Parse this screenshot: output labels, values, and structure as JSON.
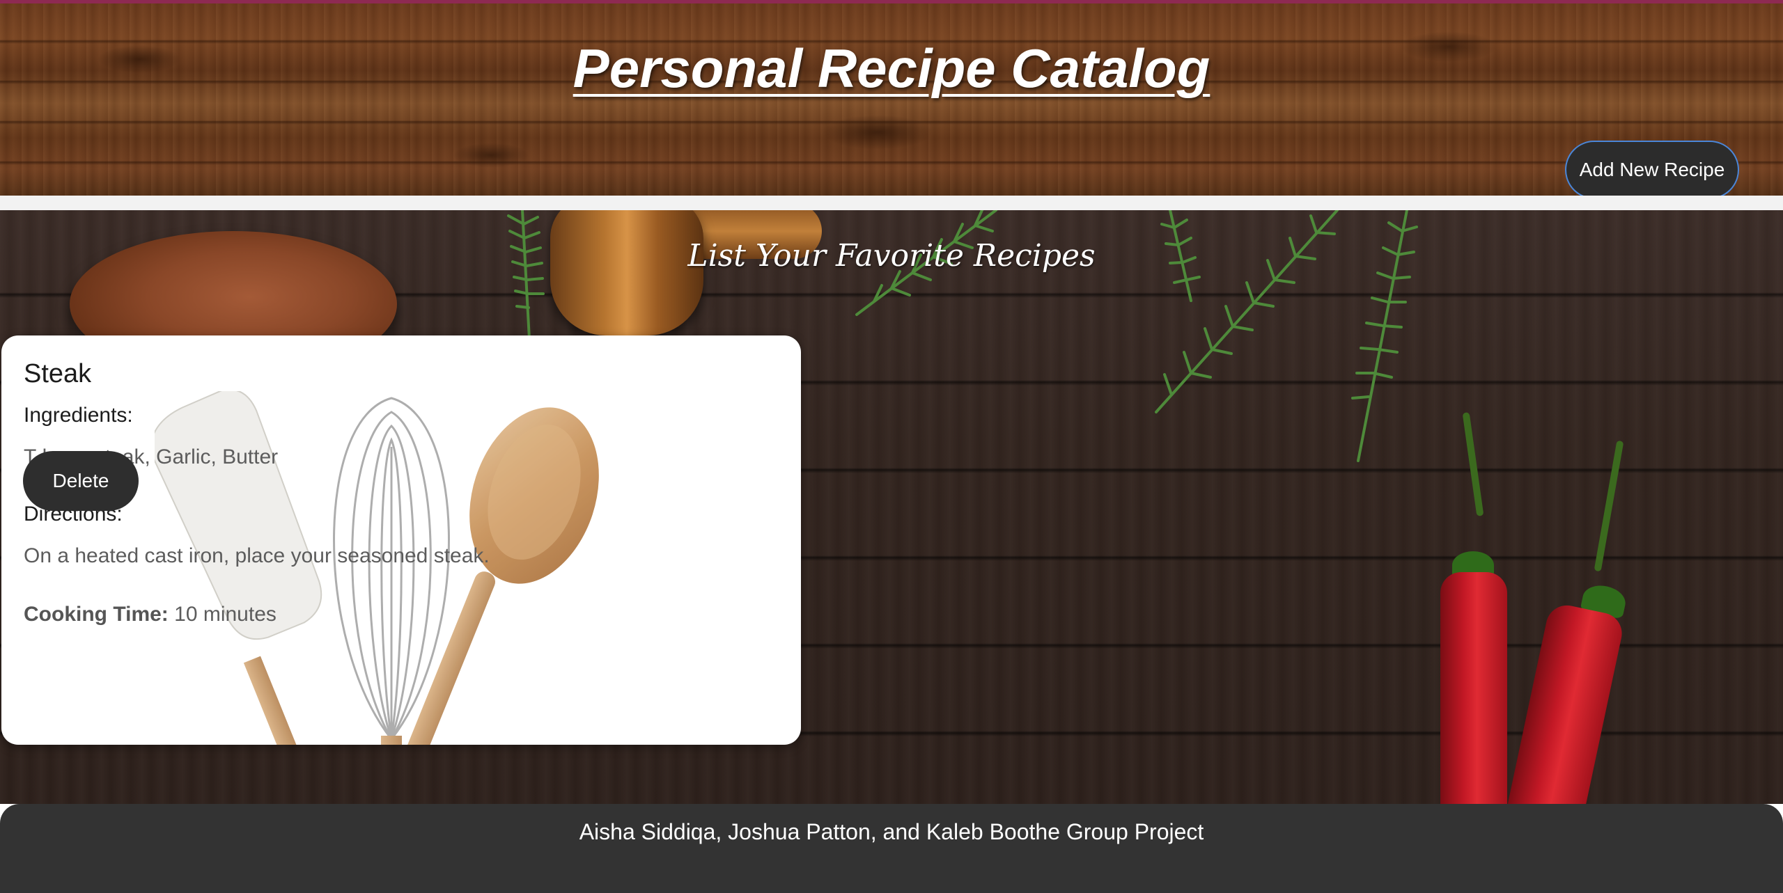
{
  "header": {
    "title": "Personal Recipe Catalog",
    "add_button_label": "Add New Recipe"
  },
  "main": {
    "subtitle": "List Your Favorite Recipes"
  },
  "recipes": [
    {
      "name": "Steak",
      "ingredients_label": "Ingredients:",
      "ingredients": "T-bone steak, Garlic, Butter",
      "directions_label": "Directions:",
      "directions": "On a heated cast iron, place your seasoned steak.",
      "cooking_time_label": "Cooking Time:",
      "cooking_time": "10 minutes",
      "delete_label": "Delete"
    }
  ],
  "footer": {
    "text": "Aisha Siddiqa, Joshua Patton, and Kaleb Boothe Group Project"
  },
  "colors": {
    "top_strip": "#8e2a52",
    "button_dark": "#2c2c2c",
    "button_border": "#4a86d8",
    "footer_bg": "#333333",
    "card_bg": "#ffffff"
  },
  "icons": {
    "card_background": "kitchen-utensils-illustration",
    "page_background": "dark-wood-with-peppers-and-rosemary"
  }
}
